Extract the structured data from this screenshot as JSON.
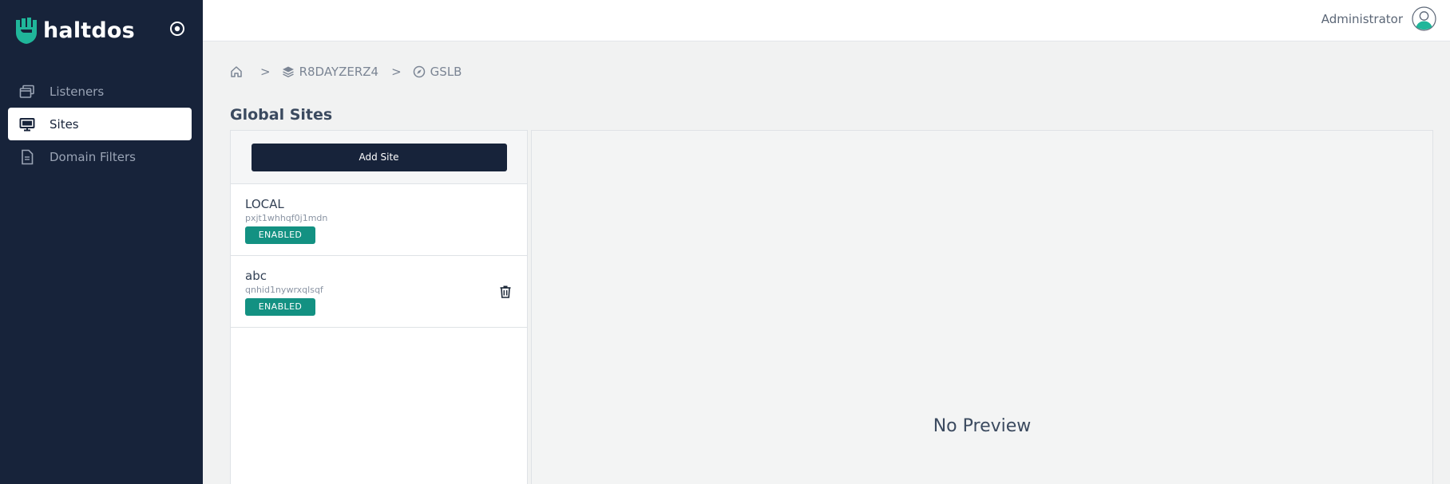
{
  "brand": {
    "name": "haltdos"
  },
  "sidebar": {
    "items": [
      {
        "label": "Listeners",
        "icon": "windows-stack-icon",
        "active": false
      },
      {
        "label": "Sites",
        "icon": "monitor-icon",
        "active": true
      },
      {
        "label": "Domain Filters",
        "icon": "document-icon",
        "active": false
      }
    ]
  },
  "topbar": {
    "user_name": "Administrator"
  },
  "breadcrumb": {
    "items": [
      {
        "label": "",
        "icon": "home-icon"
      },
      {
        "label": "R8DAYZERZ4",
        "icon": "layers-icon"
      },
      {
        "label": "GSLB",
        "icon": "compass-icon"
      }
    ],
    "separator": ">"
  },
  "page": {
    "title": "Global Sites"
  },
  "list": {
    "add_label": "Add Site",
    "sites": [
      {
        "name": "LOCAL",
        "id": "pxjt1whhqf0j1mdn",
        "status": "ENABLED",
        "deletable": false
      },
      {
        "name": "abc",
        "id": "qnhid1nywrxqlsqf",
        "status": "ENABLED",
        "deletable": true
      }
    ]
  },
  "preview": {
    "empty_text": "No Preview"
  },
  "colors": {
    "sidebar_bg": "#17233a",
    "badge_green": "#139182",
    "page_bg": "#f1f2f2",
    "logo_green": "#20b69a"
  }
}
